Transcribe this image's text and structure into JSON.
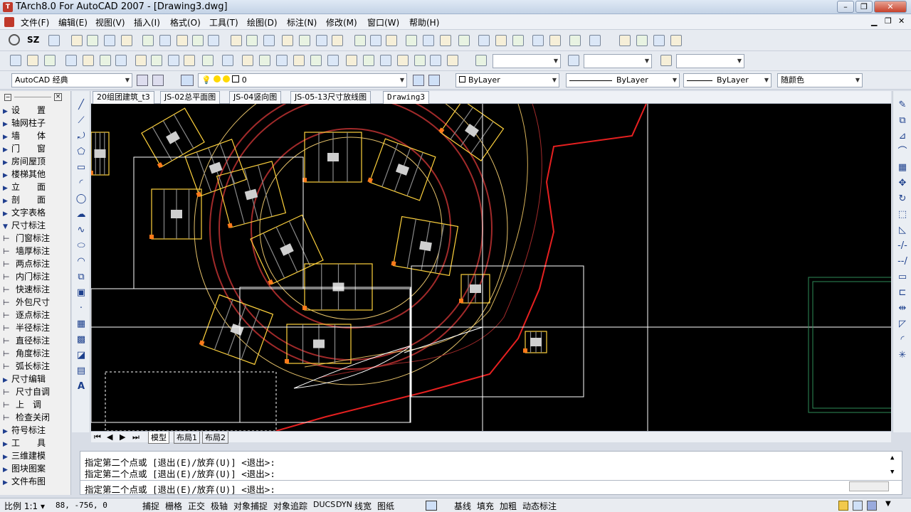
{
  "window": {
    "title": "TArch8.0 For AutoCAD 2007 - [Drawing3.dwg]",
    "controls": {
      "minimize": "–",
      "restore": "❐",
      "close": "✕"
    }
  },
  "menu": [
    {
      "label": "文件(F)"
    },
    {
      "label": "编辑(E)"
    },
    {
      "label": "视图(V)"
    },
    {
      "label": "插入(I)"
    },
    {
      "label": "格式(O)"
    },
    {
      "label": "工具(T)"
    },
    {
      "label": "绘图(D)"
    },
    {
      "label": "标注(N)"
    },
    {
      "label": "修改(M)"
    },
    {
      "label": "窗口(W)"
    },
    {
      "label": "帮助(H)"
    }
  ],
  "toolbar1": {
    "sz_label": "SZ"
  },
  "toolbar3": {
    "workspace": "AutoCAD 经典",
    "layer": "0",
    "color": "ByLayer",
    "linetype": "ByLayer",
    "lineweight": "ByLayer",
    "plotstyle": "随颜色"
  },
  "leftpanel": {
    "items": [
      {
        "label": "设　　置",
        "kind": "tri"
      },
      {
        "label": "轴网柱子",
        "kind": "tri"
      },
      {
        "label": "墙　　体",
        "kind": "tri"
      },
      {
        "label": "门　　窗",
        "kind": "tri"
      },
      {
        "label": "房间屋顶",
        "kind": "tri"
      },
      {
        "label": "楼梯其他",
        "kind": "tri"
      },
      {
        "label": "立　　面",
        "kind": "tri"
      },
      {
        "label": "剖　　面",
        "kind": "tri"
      },
      {
        "label": "文字表格",
        "kind": "tri"
      },
      {
        "label": "尺寸标注",
        "kind": "open"
      },
      {
        "label": "门窗标注",
        "kind": "sub"
      },
      {
        "label": "墙厚标注",
        "kind": "sub"
      },
      {
        "label": "两点标注",
        "kind": "sub"
      },
      {
        "label": "内门标注",
        "kind": "sub"
      },
      {
        "label": "快速标注",
        "kind": "sub"
      },
      {
        "label": "外包尺寸",
        "kind": "sub"
      },
      {
        "label": "逐点标注",
        "kind": "sub"
      },
      {
        "label": "半径标注",
        "kind": "sub"
      },
      {
        "label": "直径标注",
        "kind": "sub"
      },
      {
        "label": "角度标注",
        "kind": "sub"
      },
      {
        "label": "弧长标注",
        "kind": "sub"
      },
      {
        "label": "尺寸编辑",
        "kind": "tri"
      },
      {
        "label": "尺寸自调",
        "kind": "sub"
      },
      {
        "label": "上　调",
        "kind": "sub"
      },
      {
        "label": "检查关闭",
        "kind": "sub"
      },
      {
        "label": "符号标注",
        "kind": "tri"
      },
      {
        "label": "工　　具",
        "kind": "tri"
      },
      {
        "label": "三维建模",
        "kind": "tri"
      },
      {
        "label": "图块图案",
        "kind": "tri"
      },
      {
        "label": "文件布图",
        "kind": "tri"
      }
    ]
  },
  "filetabs": [
    {
      "label": "20组团建筑_t3"
    },
    {
      "label": "JS-02总平面图"
    },
    {
      "label": "JS-04竖向图"
    },
    {
      "label": "JS-05-13尺寸放线图"
    },
    {
      "label": "Drawing3",
      "active": true
    }
  ],
  "layouttabs": [
    {
      "label": "模型",
      "active": true
    },
    {
      "label": "布局1"
    },
    {
      "label": "布局2"
    }
  ],
  "command": {
    "lines": [
      "指定第二个点或 [退出(E)/放弃(U)] <退出>:",
      "指定第二个点或 [退出(E)/放弃(U)] <退出>:"
    ],
    "prompt": "指定第二个点或 [退出(E)/放弃(U)] <退出>:"
  },
  "status": {
    "scale": "比例 1:1 ▾",
    "coords": "88,   -756, 0",
    "toggles": [
      "捕捉",
      "栅格",
      "正交",
      "极轴",
      "对象捕捉",
      "对象追踪",
      "DUCS",
      "DYN",
      "线宽",
      "图纸"
    ],
    "toggles2": [
      "基线",
      "填充",
      "加粗",
      "动态标注"
    ]
  },
  "colors": {
    "canvas_bg": "#000000",
    "building": "#ffd23c",
    "road": "#a12a2a",
    "site_line": "#e62020",
    "highlight": "#ff7a1a",
    "outline": "#ffffff"
  }
}
